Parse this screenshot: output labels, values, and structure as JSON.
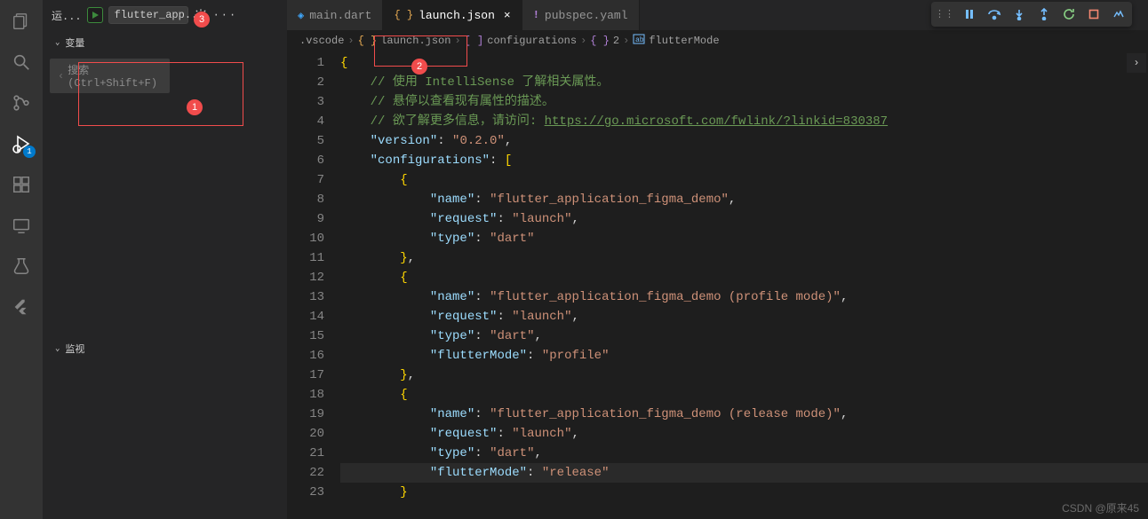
{
  "activityBar": {
    "items": [
      {
        "name": "explorer",
        "badge": null
      },
      {
        "name": "search",
        "badge": null
      },
      {
        "name": "source-control",
        "badge": null
      },
      {
        "name": "run-debug",
        "badge": "1",
        "active": true
      },
      {
        "name": "extensions",
        "badge": null
      },
      {
        "name": "remote",
        "badge": null
      },
      {
        "name": "testing",
        "badge": null
      },
      {
        "name": "flutter",
        "badge": null
      }
    ]
  },
  "runPanel": {
    "header": {
      "runLabel": "运...",
      "configName": "flutter_app...",
      "annotationBadge": "3"
    },
    "variablesSection": "变量",
    "searchPlaceholder": "搜索 (Ctrl+Shift+F)",
    "watchSection": "监视",
    "annotationBadge1": "1"
  },
  "tabs": [
    {
      "label": "main.dart",
      "iconColor": "#40a9ff",
      "active": false
    },
    {
      "label": "launch.json",
      "iconColor": "#e8ab53",
      "active": true,
      "closable": true
    },
    {
      "label": "pubspec.yaml",
      "iconColor": "#b180d7",
      "active": false
    }
  ],
  "breadcrumbs": {
    "items": [
      ".vscode",
      "launch.json",
      "configurations",
      "2",
      "flutterMode"
    ],
    "annotationBadge": "2"
  },
  "debugToolbar": {
    "buttons": [
      "grip",
      "pause",
      "step-over",
      "step-into",
      "step-out",
      "restart",
      "stop",
      "devtools"
    ]
  },
  "code": {
    "lines": [
      {
        "n": 1,
        "html": "<span class='tok-brace'>{</span>"
      },
      {
        "n": 2,
        "html": "    <span class='tok-comment'>// 使用 IntelliSense 了解相关属性。</span>"
      },
      {
        "n": 3,
        "html": "    <span class='tok-comment'>// 悬停以查看现有属性的描述。</span>"
      },
      {
        "n": 4,
        "html": "    <span class='tok-comment'>// 欲了解更多信息，请访问: </span><span class='tok-link'>https://go.microsoft.com/fwlink/?linkid=830387</span>"
      },
      {
        "n": 5,
        "html": "    <span class='tok-key'>\"version\"</span><span class='tok-punc'>: </span><span class='tok-str'>\"0.2.0\"</span><span class='tok-punc'>,</span>"
      },
      {
        "n": 6,
        "html": "    <span class='tok-key'>\"configurations\"</span><span class='tok-punc'>: </span><span class='tok-brace'>[</span>"
      },
      {
        "n": 7,
        "html": "        <span class='tok-brace'>{</span>"
      },
      {
        "n": 8,
        "html": "            <span class='tok-key'>\"name\"</span><span class='tok-punc'>: </span><span class='tok-str'>\"flutter_application_figma_demo\"</span><span class='tok-punc'>,</span>"
      },
      {
        "n": 9,
        "html": "            <span class='tok-key'>\"request\"</span><span class='tok-punc'>: </span><span class='tok-str'>\"launch\"</span><span class='tok-punc'>,</span>"
      },
      {
        "n": 10,
        "html": "            <span class='tok-key'>\"type\"</span><span class='tok-punc'>: </span><span class='tok-str'>\"dart\"</span>"
      },
      {
        "n": 11,
        "html": "        <span class='tok-brace'>}</span><span class='tok-punc'>,</span>"
      },
      {
        "n": 12,
        "html": "        <span class='tok-brace'>{</span>"
      },
      {
        "n": 13,
        "html": "            <span class='tok-key'>\"name\"</span><span class='tok-punc'>: </span><span class='tok-str'>\"flutter_application_figma_demo (profile mode)\"</span><span class='tok-punc'>,</span>"
      },
      {
        "n": 14,
        "html": "            <span class='tok-key'>\"request\"</span><span class='tok-punc'>: </span><span class='tok-str'>\"launch\"</span><span class='tok-punc'>,</span>"
      },
      {
        "n": 15,
        "html": "            <span class='tok-key'>\"type\"</span><span class='tok-punc'>: </span><span class='tok-str'>\"dart\"</span><span class='tok-punc'>,</span>"
      },
      {
        "n": 16,
        "html": "            <span class='tok-key'>\"flutterMode\"</span><span class='tok-punc'>: </span><span class='tok-str'>\"profile\"</span>"
      },
      {
        "n": 17,
        "html": "        <span class='tok-brace'>}</span><span class='tok-punc'>,</span>"
      },
      {
        "n": 18,
        "html": "        <span class='tok-brace'>{</span>"
      },
      {
        "n": 19,
        "html": "            <span class='tok-key'>\"name\"</span><span class='tok-punc'>: </span><span class='tok-str'>\"flutter_application_figma_demo (release mode)\"</span><span class='tok-punc'>,</span>"
      },
      {
        "n": 20,
        "html": "            <span class='tok-key'>\"request\"</span><span class='tok-punc'>: </span><span class='tok-str'>\"launch\"</span><span class='tok-punc'>,</span>"
      },
      {
        "n": 21,
        "html": "            <span class='tok-key'>\"type\"</span><span class='tok-punc'>: </span><span class='tok-str'>\"dart\"</span><span class='tok-punc'>,</span>"
      },
      {
        "n": 22,
        "html": "            <span class='tok-key'>\"flutterMode\"</span><span class='tok-punc'>: </span><span class='tok-str'>\"release\"</span>",
        "hl": true
      },
      {
        "n": 23,
        "html": "        <span class='tok-brace'>}</span>"
      }
    ]
  },
  "watermark": "CSDN @原来45"
}
